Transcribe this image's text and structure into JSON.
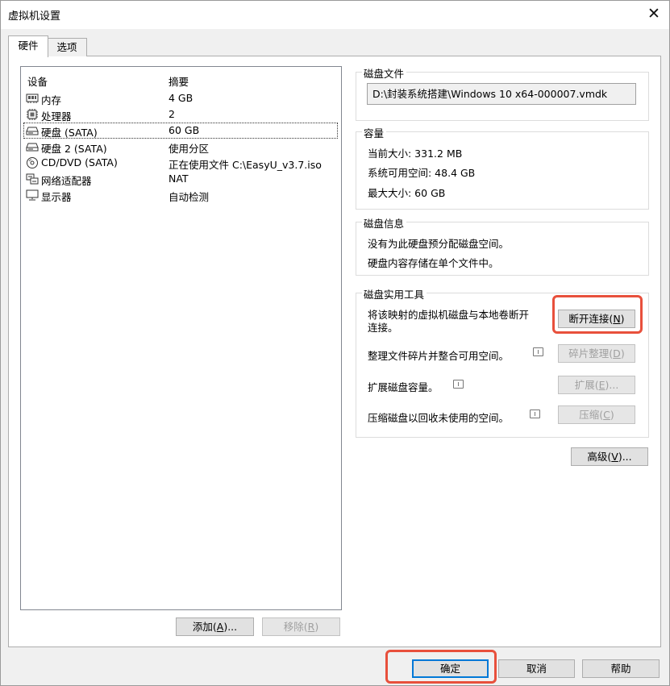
{
  "window": {
    "title": "虚拟机设置",
    "close_glyph": "✕"
  },
  "tabs": [
    {
      "label": "硬件",
      "active": true
    },
    {
      "label": "选项",
      "active": false
    }
  ],
  "device_list": {
    "headers": {
      "device": "设备",
      "summary": "摘要"
    },
    "rows": [
      {
        "icon": "memory-icon",
        "name": "内存",
        "summary": "4 GB"
      },
      {
        "icon": "processor-icon",
        "name": "处理器",
        "summary": "2"
      },
      {
        "icon": "hard-disk-icon",
        "name": "硬盘 (SATA)",
        "summary": "60 GB",
        "selected": true
      },
      {
        "icon": "hard-disk-icon",
        "name": "硬盘 2 (SATA)",
        "summary": "使用分区"
      },
      {
        "icon": "cd-dvd-icon",
        "name": "CD/DVD (SATA)",
        "summary": "正在使用文件 C:\\EasyU_v3.7.iso"
      },
      {
        "icon": "network-adapter-icon",
        "name": "网络适配器",
        "summary": "NAT"
      },
      {
        "icon": "display-icon",
        "name": "显示器",
        "summary": "自动检测"
      }
    ],
    "add_button": {
      "label": "添加(",
      "key": "A",
      "tail": ")..."
    },
    "remove_button": {
      "label": "移除(",
      "key": "R",
      "tail": ")"
    }
  },
  "disk_file": {
    "label": "磁盘文件",
    "path": "D:\\封装系统搭建\\Windows 10 x64-000007.vmdk"
  },
  "capacity": {
    "label": "容量",
    "current_size": "当前大小: 331.2 MB",
    "system_free": "系统可用空间: 48.4 GB",
    "max_size": "最大大小: 60 GB"
  },
  "disk_info": {
    "label": "磁盘信息",
    "line1": "没有为此硬盘预分配磁盘空间。",
    "line2": "硬盘内容存储在单个文件中。"
  },
  "disk_tools": {
    "label": "磁盘实用工具",
    "map_desc_line1": "将该映射的虚拟机磁盘与本地卷断开",
    "map_desc_line2": "连接。",
    "disconnect_button": {
      "label": "断开连接(",
      "key": "N",
      "tail": ")"
    },
    "defrag_desc": "整理文件碎片并整合可用空间。",
    "defrag_button": {
      "label": "碎片整理(",
      "key": "D",
      "tail": ")"
    },
    "expand_desc": "扩展磁盘容量。",
    "expand_button": {
      "label": "扩展(",
      "key": "E",
      "tail": ")..."
    },
    "compact_desc": "压缩磁盘以回收未使用的空间。",
    "compact_button": {
      "label": "压缩(",
      "key": "C",
      "tail": ")"
    }
  },
  "advanced_button": {
    "label": "高级(",
    "key": "V",
    "tail": ")..."
  },
  "footer": {
    "ok": "确定",
    "cancel": "取消",
    "help": "帮助"
  },
  "colors": {
    "highlight_box": "#e8503c",
    "default_button_border": "#0078d7"
  }
}
